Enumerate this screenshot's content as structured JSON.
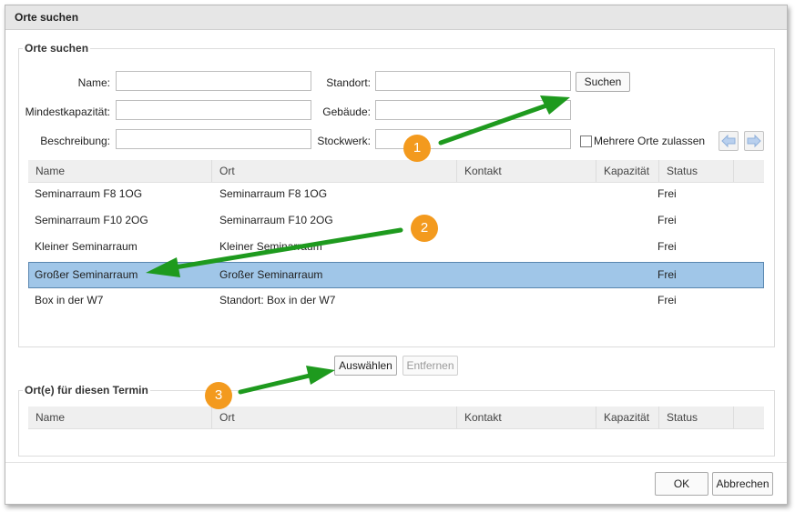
{
  "dialog": {
    "title": "Orte suchen"
  },
  "search": {
    "legend": "Orte suchen",
    "name_label": "Name:",
    "capacity_label": "Mindestkapazität:",
    "description_label": "Beschreibung:",
    "location_label": "Standort:",
    "building_label": "Gebäude:",
    "floor_label": "Stockwerk:",
    "search_button": "Suchen",
    "multi_label": "Mehrere Orte zulassen",
    "name_value": "",
    "capacity_value": "",
    "description_value": "",
    "location_value": "",
    "building_value": "",
    "floor_value": ""
  },
  "columns": [
    "Name",
    "Ort",
    "Kontakt",
    "Kapazität",
    "Status"
  ],
  "results": [
    {
      "name": "Seminarraum F8 1OG",
      "ort": "Seminarraum F8 1OG",
      "kontakt": "",
      "kapazitaet": "",
      "status": "Frei"
    },
    {
      "name": "Seminarraum F10 2OG",
      "ort": "Seminarraum F10 2OG",
      "kontakt": "",
      "kapazitaet": "",
      "status": "Frei"
    },
    {
      "name": "Kleiner Seminarraum",
      "ort": "Kleiner Seminarraum",
      "kontakt": "",
      "kapazitaet": "",
      "status": "Frei"
    },
    {
      "name": "Großer Seminarraum",
      "ort": "Großer Seminarraum",
      "kontakt": "",
      "kapazitaet": "",
      "status": "Frei"
    },
    {
      "name": "Box in der W7",
      "ort": "Standort: Box in der W7",
      "kontakt": "",
      "kapazitaet": "",
      "status": "Frei"
    }
  ],
  "selected_row": 3,
  "actions": {
    "select_button": "Auswählen",
    "remove_button": "Entfernen"
  },
  "assigned": {
    "legend": "Ort(e) für diesen Termin"
  },
  "footer": {
    "ok_button": "OK",
    "cancel_button": "Abbrechen"
  },
  "annotations": {
    "step1": "1",
    "step2": "2",
    "step3": "3",
    "color": "#f39a1e",
    "arrow_color": "#1e9a1e"
  },
  "colors": {
    "selected_row": "#a0c6e8",
    "header_bg": "#efefef"
  },
  "icons": {
    "prev": "arrow-left-icon",
    "next": "arrow-right-icon"
  }
}
